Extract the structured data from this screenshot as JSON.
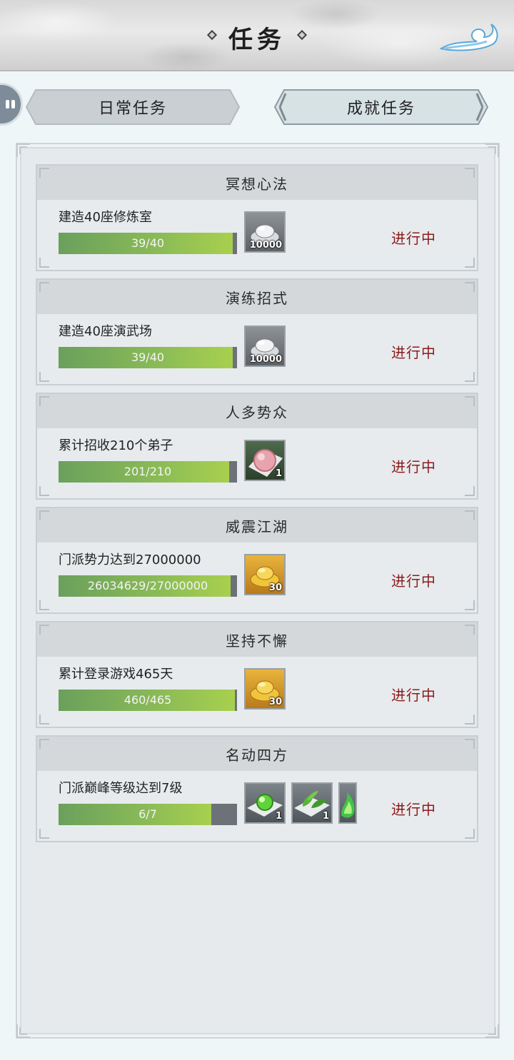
{
  "header": {
    "title": "任务"
  },
  "tabs": [
    {
      "label": "日常任务"
    },
    {
      "label": "成就任务"
    }
  ],
  "tasks": [
    {
      "title": "冥想心法",
      "desc": "建造40座修炼室",
      "progress_text": "39/40",
      "progress": 0.975,
      "status": "进行中",
      "rewards": [
        {
          "icon": "silver-ingot-icon",
          "count": "10000"
        }
      ]
    },
    {
      "title": "演练招式",
      "desc": "建造40座演武场",
      "progress_text": "39/40",
      "progress": 0.975,
      "status": "进行中",
      "rewards": [
        {
          "icon": "silver-ingot-icon",
          "count": "10000"
        }
      ]
    },
    {
      "title": "人多势众",
      "desc": "累计招收210个弟子",
      "progress_text": "201/210",
      "progress": 0.957,
      "status": "进行中",
      "rewards": [
        {
          "icon": "pink-pill-icon",
          "count": "1"
        }
      ]
    },
    {
      "title": "威震江湖",
      "desc": "门派势力达到27000000",
      "progress_text": "26034629/27000000",
      "progress": 0.964,
      "status": "进行中",
      "rewards": [
        {
          "icon": "gold-ingot-icon",
          "count": "30"
        }
      ]
    },
    {
      "title": "坚持不懈",
      "desc": "累计登录游戏465天",
      "progress_text": "460/465",
      "progress": 0.989,
      "status": "进行中",
      "rewards": [
        {
          "icon": "gold-ingot-icon",
          "count": "30"
        }
      ]
    },
    {
      "title": "名动四方",
      "desc": "门派巅峰等级达到7级",
      "progress_text": "6/7",
      "progress": 0.857,
      "status": "进行中",
      "rewards": [
        {
          "icon": "green-orb-icon",
          "count": "1"
        },
        {
          "icon": "herb-leaves-icon",
          "count": "1"
        },
        {
          "icon": "green-flame-icon",
          "count": ""
        }
      ]
    }
  ]
}
